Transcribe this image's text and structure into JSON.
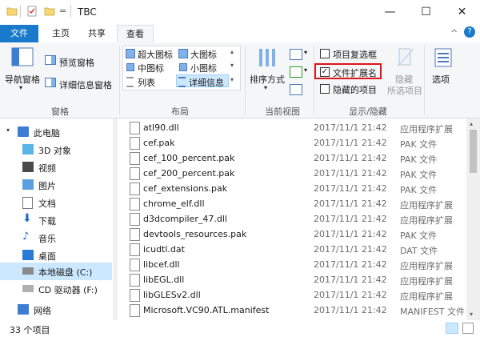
{
  "window": {
    "title": "TBC",
    "qa_dropdown": "=",
    "controls": {
      "minimize": "—",
      "maximize": "☐",
      "close": "✕"
    }
  },
  "ribbon_tabs": [
    {
      "label": "文件"
    },
    {
      "label": "主页"
    },
    {
      "label": "共享"
    },
    {
      "label": "查看"
    }
  ],
  "ribbon": {
    "collapse_glyph": "^",
    "help_glyph": "?",
    "panes": {
      "nav_pane": "导航窗格",
      "preview_pane": "预览窗格",
      "details_pane": "详细信息窗格",
      "group": "窗格"
    },
    "layout": {
      "extra_large": "超大图标",
      "large": "大图标",
      "medium": "中图标",
      "small": "小图标",
      "list": "列表",
      "details": "详细信息",
      "group": "布局"
    },
    "current_view": {
      "sort_by": "排序方式",
      "group": "当前视图"
    },
    "show_hide": {
      "item_checkboxes": "项目复选框",
      "file_ext": "文件扩展名",
      "hidden_items": "隐藏的项目",
      "hide": "隐藏",
      "selected_items": "所选项目",
      "group": "显示/隐藏",
      "item_checkboxes_checked": false,
      "file_ext_checked": true,
      "hidden_items_checked": false
    },
    "options": "选项"
  },
  "nav": {
    "items": [
      {
        "label": "此电脑",
        "icon": "computer-icon"
      },
      {
        "label": "3D 对象",
        "icon": "cube-3d-icon"
      },
      {
        "label": "视频",
        "icon": "video-icon"
      },
      {
        "label": "图片",
        "icon": "picture-icon"
      },
      {
        "label": "文档",
        "icon": "document-icon"
      },
      {
        "label": "下载",
        "icon": "download-icon"
      },
      {
        "label": "音乐",
        "icon": "music-icon"
      },
      {
        "label": "桌面",
        "icon": "desktop-icon"
      },
      {
        "label": "本地磁盘 (C:)",
        "icon": "drive-icon"
      },
      {
        "label": "CD 驱动器 (F:)",
        "icon": "cd-drive-icon"
      },
      {
        "label": "网络",
        "icon": "network-icon"
      }
    ]
  },
  "files": [
    {
      "name": "atl90.dll",
      "date": "2017/11/1 21:42",
      "type": "应用程序扩展"
    },
    {
      "name": "cef.pak",
      "date": "2017/11/1 21:42",
      "type": "PAK 文件"
    },
    {
      "name": "cef_100_percent.pak",
      "date": "2017/11/1 21:42",
      "type": "PAK 文件"
    },
    {
      "name": "cef_200_percent.pak",
      "date": "2017/11/1 21:42",
      "type": "PAK 文件"
    },
    {
      "name": "cef_extensions.pak",
      "date": "2017/11/1 21:42",
      "type": "PAK 文件"
    },
    {
      "name": "chrome_elf.dll",
      "date": "2017/11/1 21:42",
      "type": "应用程序扩展"
    },
    {
      "name": "d3dcompiler_47.dll",
      "date": "2017/11/1 21:42",
      "type": "应用程序扩展"
    },
    {
      "name": "devtools_resources.pak",
      "date": "2017/11/1 21:42",
      "type": "PAK 文件"
    },
    {
      "name": "icudtl.dat",
      "date": "2017/11/1 21:42",
      "type": "DAT 文件"
    },
    {
      "name": "libcef.dll",
      "date": "2017/11/1 21:42",
      "type": "应用程序扩展"
    },
    {
      "name": "libEGL.dll",
      "date": "2017/11/1 21:42",
      "type": "应用程序扩展"
    },
    {
      "name": "libGLESv2.dll",
      "date": "2017/11/1 21:42",
      "type": "应用程序扩展"
    },
    {
      "name": "Microsoft.VC90.ATL.manifest",
      "date": "2017/11/1 21:42",
      "type": "MANIFEST 文件"
    }
  ],
  "status": {
    "count": "33 个项目"
  },
  "colors": {
    "accent": "#1979ca",
    "highlight": "#cce8ff",
    "annotation": "#e0121a"
  }
}
